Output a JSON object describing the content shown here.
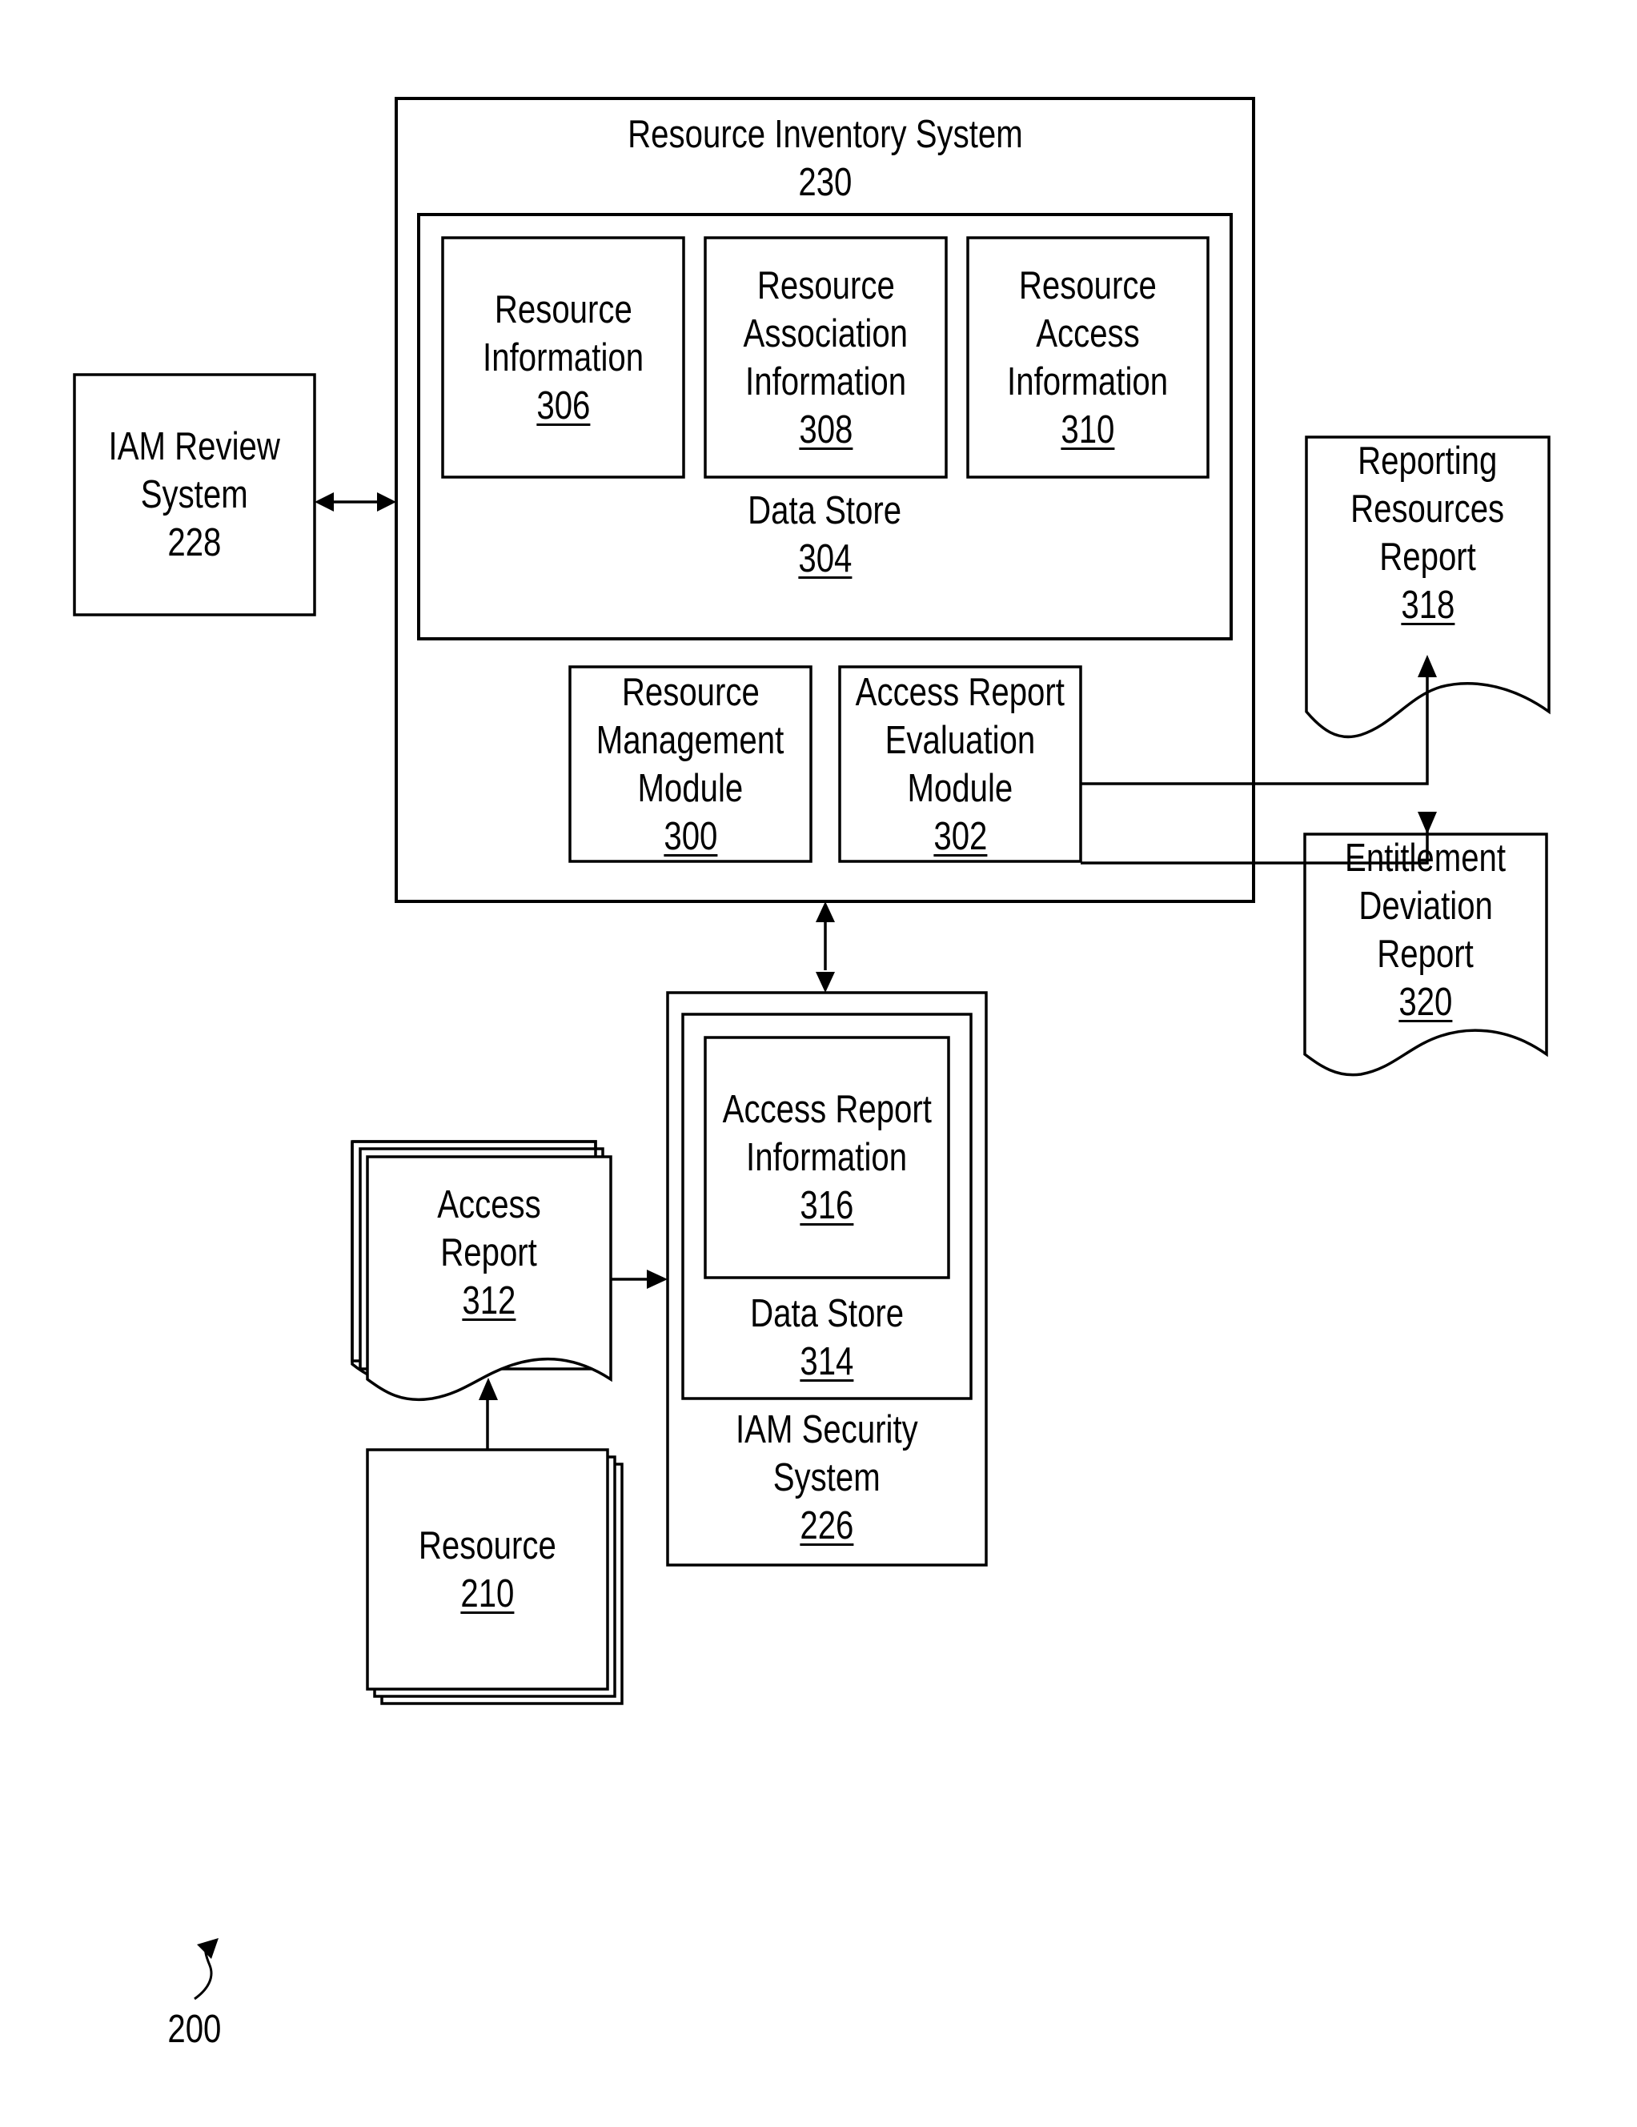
{
  "figure_label": "200",
  "nodes": {
    "resource_inventory_system": {
      "lines": [
        "Resource Inventory System"
      ],
      "ref": "230"
    },
    "data_store_304": {
      "lines": [
        "Data Store"
      ],
      "ref": "304"
    },
    "resource_information": {
      "lines": [
        "Resource",
        "Information"
      ],
      "ref": "306"
    },
    "resource_association_information": {
      "lines": [
        "Resource",
        "Association",
        "Information"
      ],
      "ref": "308"
    },
    "resource_access_information": {
      "lines": [
        "Resource",
        "Access",
        "Information"
      ],
      "ref": "310"
    },
    "resource_management_module": {
      "lines": [
        "Resource",
        "Management",
        "Module"
      ],
      "ref": "300"
    },
    "access_report_evaluation_module": {
      "lines": [
        "Access Report",
        "Evaluation",
        "Module"
      ],
      "ref": "302"
    },
    "iam_review_system": {
      "lines": [
        "IAM Review",
        "System"
      ],
      "ref": "228"
    },
    "reporting_resources_report": {
      "lines": [
        "Reporting",
        "Resources",
        "Report"
      ],
      "ref": "318"
    },
    "entitlement_deviation_report": {
      "lines": [
        "Entitlement",
        "Deviation",
        "Report"
      ],
      "ref": "320"
    },
    "iam_security_system": {
      "lines": [
        "IAM Security",
        "System"
      ],
      "ref": "226"
    },
    "data_store_314": {
      "lines": [
        "Data Store"
      ],
      "ref": "314"
    },
    "access_report_information": {
      "lines": [
        "Access Report",
        "Information"
      ],
      "ref": "316"
    },
    "access_report": {
      "lines": [
        "Access",
        "Report"
      ],
      "ref": "312"
    },
    "resource": {
      "lines": [
        "Resource"
      ],
      "ref": "210"
    }
  },
  "edges": [
    {
      "from": "iam_review_system",
      "to": "resource_inventory_system",
      "direction": "bidirectional"
    },
    {
      "from": "resource_inventory_system",
      "to": "iam_security_system",
      "direction": "bidirectional"
    },
    {
      "from": "access_report_evaluation_module",
      "to": "reporting_resources_report",
      "direction": "forward"
    },
    {
      "from": "access_report_evaluation_module",
      "to": "entitlement_deviation_report",
      "direction": "forward"
    },
    {
      "from": "access_report",
      "to": "iam_security_system",
      "direction": "forward"
    },
    {
      "from": "resource",
      "to": "access_report",
      "direction": "forward"
    }
  ]
}
